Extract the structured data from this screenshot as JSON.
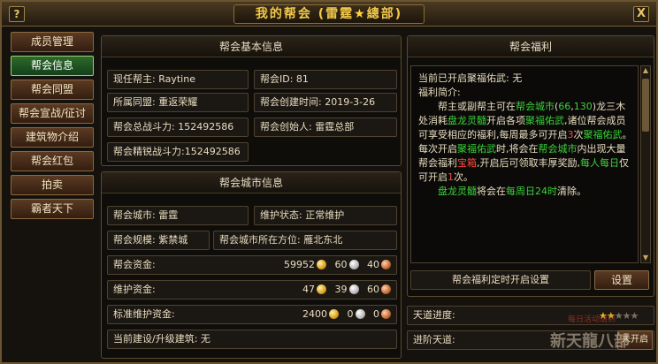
{
  "window": {
    "title_prefix": "我的帮会 (雷霆",
    "title_star": "★",
    "title_suffix": "總部)",
    "help_label": "?",
    "close_label": "X"
  },
  "nav": [
    {
      "label": "成员管理",
      "active": false
    },
    {
      "label": "帮会信息",
      "active": true
    },
    {
      "label": "帮会同盟",
      "active": false
    },
    {
      "label": "帮会宣战/征讨",
      "active": false
    },
    {
      "label": "建筑物介绍",
      "active": false
    },
    {
      "label": "帮会红包",
      "active": false
    },
    {
      "label": "拍卖",
      "active": false
    },
    {
      "label": "霸者天下",
      "active": false
    }
  ],
  "basic": {
    "header": "帮会基本信息",
    "leader": "现任帮主: Raytine",
    "guild_id": "帮会ID: 81",
    "alliance": "所属同盟: 重返荣耀",
    "created": "帮会创建时间: 2019-3-26",
    "total_power": "帮会总战斗力: 152492586",
    "founder": "帮会创始人: 雷霆总部",
    "elite_power": "帮会精锐战斗力:152492586"
  },
  "city": {
    "header": "帮会城市信息",
    "city": "帮会城市: 雷霆",
    "maintain": "维护状态: 正常维护",
    "scale": "帮会规模: 紫禁城",
    "location": "帮会城市所在方位: 雁北东北",
    "funds_label": "帮会资金:",
    "funds": [
      "59952",
      "60",
      "40"
    ],
    "upkeep_label": "维护资金:",
    "upkeep": [
      "47",
      "39",
      "60"
    ],
    "std_label": "标准维护资金:",
    "std": [
      "2400",
      "0",
      "0"
    ],
    "building": "当前建设/升级建筑: 无"
  },
  "welfare": {
    "header": "帮会福利",
    "current": "当前已开启聚福佑武: 无",
    "intro": "福利简介:",
    "para1": [
      {
        "t": "帮主或副帮主可在",
        "c": "w"
      },
      {
        "t": "帮会城市",
        "c": "g"
      },
      {
        "t": "(",
        "c": "w"
      },
      {
        "t": "66",
        "c": "g"
      },
      {
        "t": ",",
        "c": "w"
      },
      {
        "t": "130",
        "c": "g"
      },
      {
        "t": ")龙三木处消耗",
        "c": "w"
      },
      {
        "t": "盘龙灵髓",
        "c": "g"
      },
      {
        "t": "开启各项",
        "c": "w"
      },
      {
        "t": "聚福佑武",
        "c": "g"
      },
      {
        "t": ",诸位帮会成员可享受相应的福利,每周最多可开启",
        "c": "w"
      },
      {
        "t": "3",
        "c": "r"
      },
      {
        "t": "次",
        "c": "w"
      },
      {
        "t": "聚福佑武",
        "c": "g"
      },
      {
        "t": "。每次开启",
        "c": "w"
      },
      {
        "t": "聚福佑武",
        "c": "g"
      },
      {
        "t": "时,将会在",
        "c": "w"
      },
      {
        "t": "帮会城市",
        "c": "g"
      },
      {
        "t": "内出现大量帮会福利",
        "c": "w"
      },
      {
        "t": "宝箱",
        "c": "r"
      },
      {
        "t": ",开启后可领取丰厚奖励,",
        "c": "w"
      },
      {
        "t": "每人每日",
        "c": "g"
      },
      {
        "t": "仅可开启",
        "c": "w"
      },
      {
        "t": "1",
        "c": "r"
      },
      {
        "t": "次。",
        "c": "w"
      }
    ],
    "para2": [
      {
        "t": "盘龙灵髓",
        "c": "g"
      },
      {
        "t": "将会在",
        "c": "w"
      },
      {
        "t": "每周日24时",
        "c": "g"
      },
      {
        "t": "清除。",
        "c": "w"
      }
    ],
    "timer_label": "帮会福利定时开启设置",
    "settings_button": "设置"
  },
  "tiandao": {
    "progress_label": "天道进度:",
    "stars_on": "★★",
    "stars_off": "★★★",
    "advance_label": "进阶天道:",
    "advance_status": "未开启"
  },
  "logo": {
    "top_text": "每日活动请到",
    "brand": "新天龍八部"
  }
}
